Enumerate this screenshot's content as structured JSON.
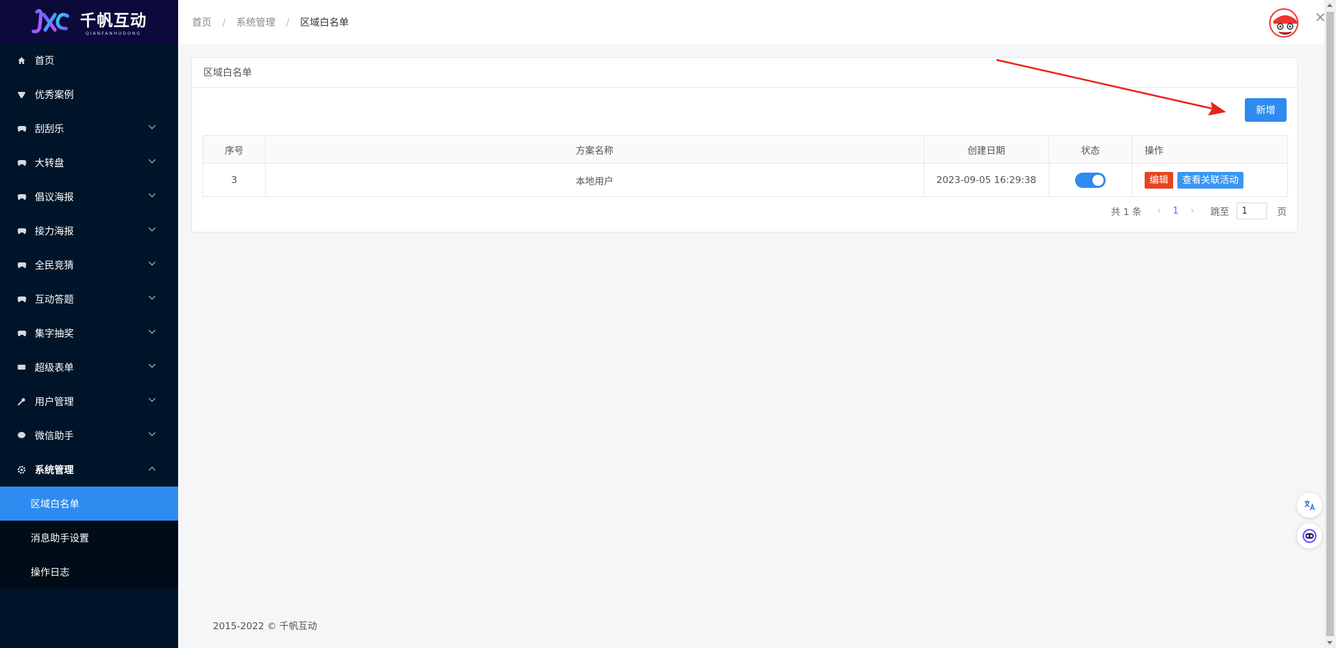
{
  "logo": {
    "title": "千帆互动",
    "subtitle": "QIANFANHUDONG"
  },
  "sidebar": {
    "items": [
      {
        "label": "首页",
        "icon": "home-icon",
        "expandable": false
      },
      {
        "label": "优秀案例",
        "icon": "trophy-icon",
        "expandable": false
      },
      {
        "label": "刮刮乐",
        "icon": "gamepad-icon",
        "expandable": true
      },
      {
        "label": "大转盘",
        "icon": "gamepad-icon",
        "expandable": true
      },
      {
        "label": "倡议海报",
        "icon": "gamepad-icon",
        "expandable": true
      },
      {
        "label": "接力海报",
        "icon": "gamepad-icon",
        "expandable": true
      },
      {
        "label": "全民竞猜",
        "icon": "gamepad-icon",
        "expandable": true
      },
      {
        "label": "互动答题",
        "icon": "gamepad-icon",
        "expandable": true
      },
      {
        "label": "集字抽奖",
        "icon": "gamepad-icon",
        "expandable": true
      },
      {
        "label": "超级表单",
        "icon": "keyboard-icon",
        "expandable": true
      },
      {
        "label": "用户管理",
        "icon": "wrench-icon",
        "expandable": true
      },
      {
        "label": "微信助手",
        "icon": "chat-icon",
        "expandable": true
      },
      {
        "label": "系统管理",
        "icon": "gear-icon",
        "expandable": true,
        "open": true
      }
    ],
    "sub_items": [
      {
        "label": "区域白名单",
        "active": true
      },
      {
        "label": "消息助手设置",
        "active": false
      },
      {
        "label": "操作日志",
        "active": false
      }
    ]
  },
  "breadcrumb": [
    "首页",
    "系统管理",
    "区域白名单"
  ],
  "card": {
    "title": "区域白名单",
    "add_label": "新增"
  },
  "table": {
    "headers": [
      "序号",
      "方案名称",
      "创建日期",
      "状态",
      "操作"
    ],
    "rows": [
      {
        "id": "3",
        "name": "本地用户",
        "created": "2023-09-05 16:29:38",
        "enabled": true,
        "edit_label": "编辑",
        "view_label": "查看关联活动"
      }
    ]
  },
  "pagination": {
    "total_text": "共 1 条",
    "current": "1",
    "jump_label": "跳至",
    "jump_value": "1",
    "page_label": "页"
  },
  "footer": {
    "text": "2015-2022 © 千帆互动"
  },
  "colors": {
    "primary": "#2f8bf0",
    "sidebar": "#001529",
    "danger": "#e8431f",
    "arrow": "#e8241a"
  }
}
